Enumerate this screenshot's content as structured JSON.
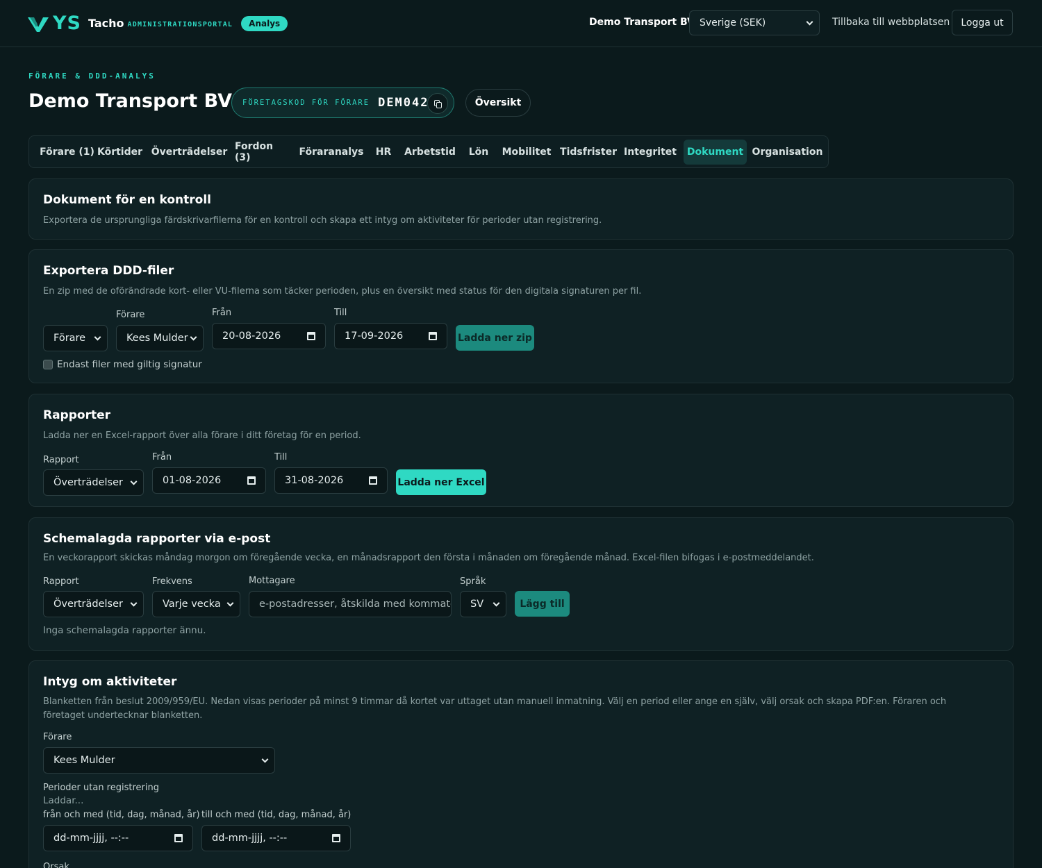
{
  "header": {
    "logo_ys": "YS",
    "logo_tacho": "Tacho",
    "logo_admin": "ADMINISTRATIONSPORTAL",
    "badge": "Analys",
    "company": "Demo Transport BV",
    "region_select": "Sverige (SEK)",
    "back_link": "Tillbaka till webbplatsen",
    "logout": "Logga ut"
  },
  "page": {
    "eyebrow": "FÖRARE & DDD-ANALYS",
    "title": "Demo Transport BV",
    "code_label": "FÖRETAGSKOD FÖR FÖRARE",
    "code_value": "DEM042",
    "overview_button": "Översikt"
  },
  "tabs": [
    {
      "label": "Förare (1)"
    },
    {
      "label": "Körtider"
    },
    {
      "label": "Överträdelser"
    },
    {
      "label": "Fordon (3)"
    },
    {
      "label": "Föraranalys"
    },
    {
      "label": "HR"
    },
    {
      "label": "Arbetstid"
    },
    {
      "label": "Lön"
    },
    {
      "label": "Mobilitet"
    },
    {
      "label": "Tidsfrister"
    },
    {
      "label": "Integritet"
    },
    {
      "label": "Dokument",
      "active": true
    },
    {
      "label": "Organisation"
    }
  ],
  "control_docs": {
    "title": "Dokument för en kontroll",
    "desc": "Exportera de ursprungliga färdskrivarfilerna för en kontroll och skapa ett intyg om aktiviteter för perioder utan registrering."
  },
  "export_ddd": {
    "title": "Exportera DDD-filer",
    "desc": "En zip med de oförändrade kort- eller VU-filerna som täcker perioden, plus en översikt med status för den digitala signaturen per fil.",
    "type_select": "Förare",
    "driver_label": "Förare",
    "driver_select": "Kees Mulder",
    "from_label": "Från",
    "from_value": "20-08-2026",
    "to_label": "Till",
    "to_value": "17-09-2026",
    "download_button": "Ladda ner zip",
    "checkbox_label": "Endast filer med giltig signatur"
  },
  "reports": {
    "title": "Rapporter",
    "desc": "Ladda ner en Excel-rapport över alla förare i ditt företag för en period.",
    "report_label": "Rapport",
    "report_select": "Överträdelser",
    "from_label": "Från",
    "from_value": "01-08-2026",
    "to_label": "Till",
    "to_value": "31-08-2026",
    "download_button": "Ladda ner Excel"
  },
  "scheduled": {
    "title": "Schemalagda rapporter via e-post",
    "desc": "En veckorapport skickas måndag morgon om föregående vecka, en månadsrapport den första i månaden om föregående månad. Excel-filen bifogas i e-postmeddelandet.",
    "report_label": "Rapport",
    "report_select": "Överträdelser",
    "freq_label": "Frekvens",
    "freq_select": "Varje vecka",
    "recipients_label": "Mottagare",
    "recipients_placeholder": "e-postadresser, åtskilda med kommatec",
    "lang_label": "Språk",
    "lang_select": "SV",
    "add_button": "Lägg till",
    "empty_text": "Inga schemalagda rapporter ännu."
  },
  "activities": {
    "title": "Intyg om aktiviteter",
    "desc": "Blanketten från beslut 2009/959/EU. Nedan visas perioder på minst 9 timmar då kortet var uttaget utan manuell inmatning. Välj en period eller ange en själv, välj orsak och skapa PDF:en. Föraren och företaget undertecknar blanketten.",
    "driver_label": "Förare",
    "driver_select": "Kees Mulder",
    "periods_label": "Perioder utan registrering",
    "loading_text": "Laddar...",
    "from_label": "från och med (tid, dag, månad, år)",
    "from_placeholder": "dd-mm-jjjj, --:--",
    "to_label": "till och med (tid, dag, månad, år)",
    "to_placeholder": "dd-mm-jjjj, --:--",
    "reason_label": "Orsak"
  },
  "colors": {
    "background": "#0b1a1c",
    "accent": "#2fd9c3",
    "card": "#0f2124"
  }
}
